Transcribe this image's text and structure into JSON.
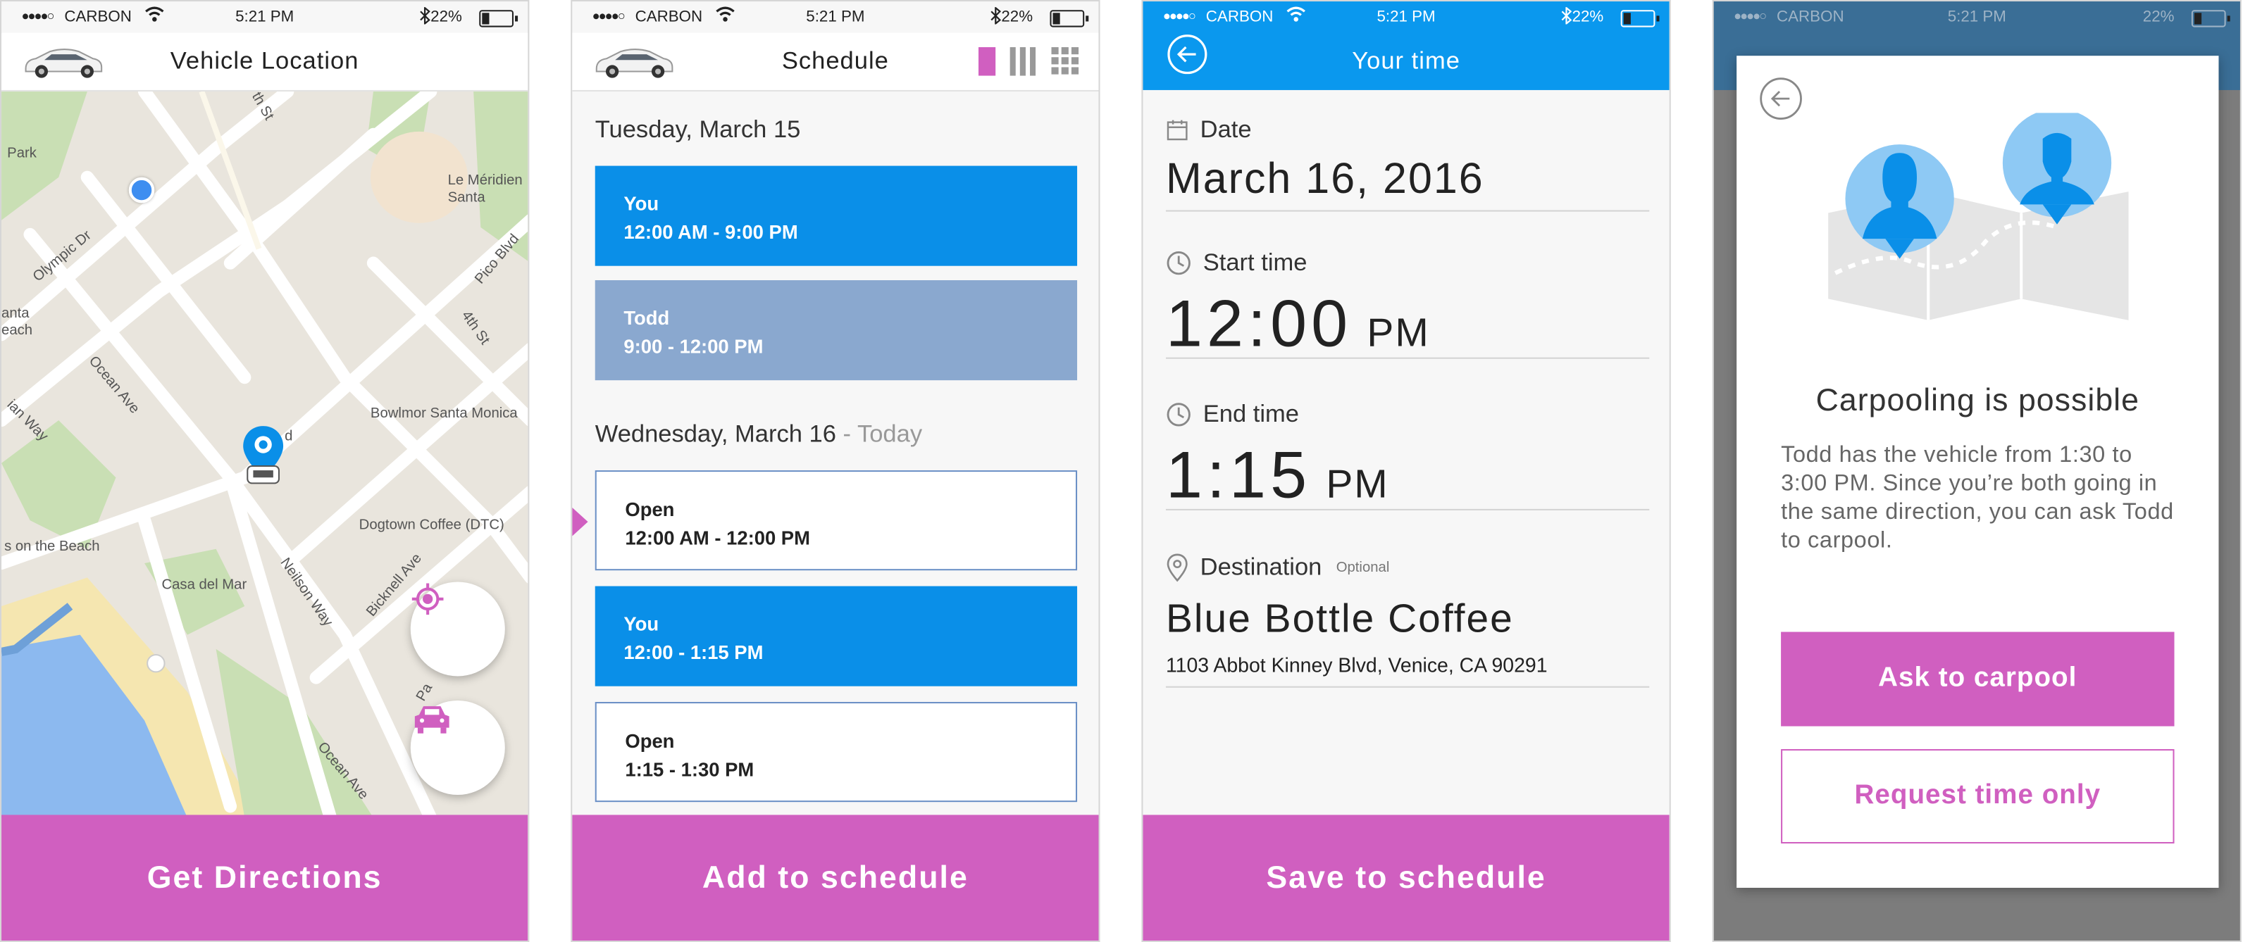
{
  "status_bar": {
    "carrier": "CARBON",
    "time": "5:21 PM",
    "battery": "22%"
  },
  "colors": {
    "accent": "#d05fc0",
    "blue": "#0a98ee",
    "slot_blue": "#0a8fe8",
    "slot_gray": "#8aa8cf"
  },
  "screen1": {
    "title": "Vehicle Location",
    "map_labels": [
      "Park",
      "Olympic Dr",
      "Le Méridien Santa",
      "Pico Blvd",
      "4th St",
      "anta each",
      "Ocean Ave",
      "Bowlmor Santa Monica",
      "ian Way",
      "Dogtown Coffee (DTC)",
      "s on the Beach",
      "Casa del Mar",
      "Neilson Way",
      "Bicknell Ave",
      "Ocean Ave",
      "Pa",
      "th St",
      "Pi",
      "d"
    ],
    "button": "Get Directions",
    "icons": [
      "locate-icon",
      "car-front-icon",
      "map-pin-icon"
    ]
  },
  "screen2": {
    "title": "Schedule",
    "days": [
      {
        "label": "Tuesday, March 15",
        "suffix": ""
      },
      {
        "label": "Wednesday, March 16",
        "suffix": " - Today"
      }
    ],
    "slots": [
      {
        "name": "You",
        "time": "12:00 AM - 9:00 PM",
        "kind": "you"
      },
      {
        "name": "Todd",
        "time": "9:00 - 12:00 PM",
        "kind": "other"
      },
      {
        "name": "Open",
        "time": "12:00 AM - 12:00 PM",
        "kind": "open"
      },
      {
        "name": "You",
        "time": "12:00 - 1:15 PM",
        "kind": "you"
      },
      {
        "name": "Open",
        "time": "1:15 - 1:30 PM",
        "kind": "open"
      }
    ],
    "button": "Add to schedule"
  },
  "screen3": {
    "title": "Your time",
    "date_label": "Date",
    "date_value": "March 16, 2016",
    "start_label": "Start time",
    "start_value": "12:00",
    "start_period": "PM",
    "end_label": "End time",
    "end_value": "1:15",
    "end_period": "PM",
    "dest_label": "Destination",
    "dest_optional": "Optional",
    "dest_name": "Blue Bottle Coffee",
    "dest_address": "1103 Abbot Kinney Blvd, Venice, CA 90291",
    "button": "Save to schedule"
  },
  "screen4": {
    "heading": "Carpooling is possible",
    "body": "Todd has the vehicle from 1:30 to 3:00 PM. Since you’re both going in the same direction, you can ask Todd to carpool.",
    "primary": "Ask to carpool",
    "secondary": "Request time only"
  }
}
